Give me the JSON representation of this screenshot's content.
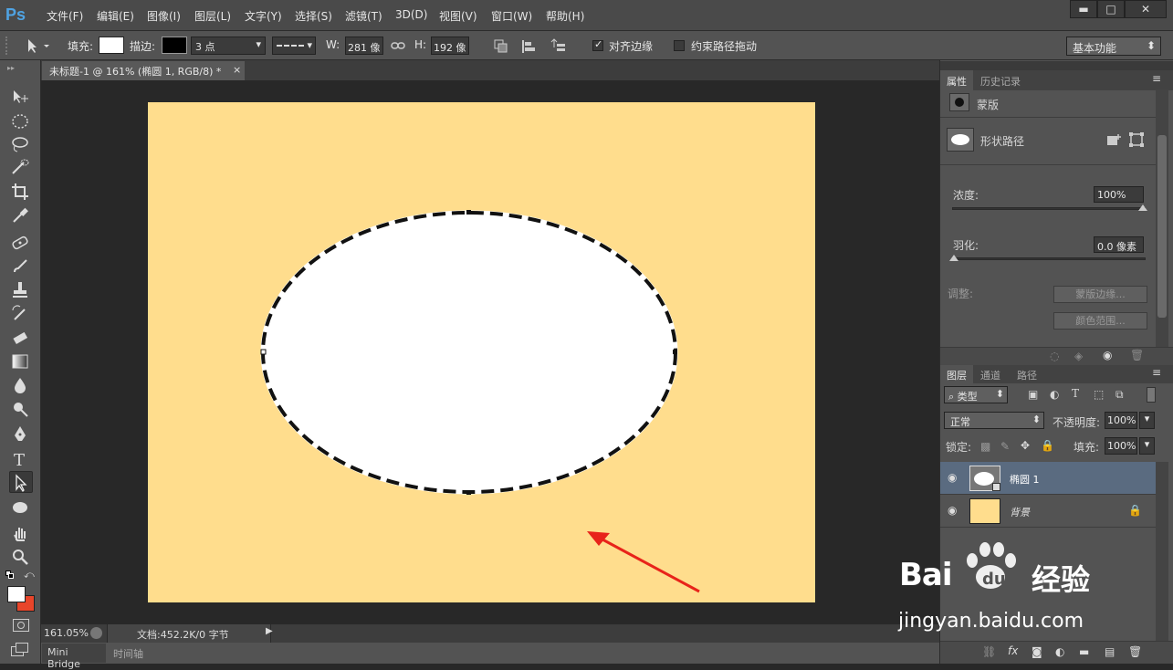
{
  "app": {
    "logo": "Ps"
  },
  "menu": [
    "文件(F)",
    "编辑(E)",
    "图像(I)",
    "图层(L)",
    "文字(Y)",
    "选择(S)",
    "滤镜(T)",
    "3D(D)",
    "视图(V)",
    "窗口(W)",
    "帮助(H)"
  ],
  "window_controls": {
    "minimize": "▬",
    "maximize": "□",
    "close": "✕"
  },
  "options": {
    "fill_label": "填充:",
    "stroke_label": "描边:",
    "stroke_width": "3 点",
    "w_label": "W:",
    "w_value": "281 像",
    "h_label": "H:",
    "h_value": "192 像",
    "align_edges": "对齐边缘",
    "constrain": "约束路径拖动",
    "workspace": "基本功能",
    "align_edges_checked": true,
    "constrain_checked": false
  },
  "document": {
    "tab_title": "未标题-1 @ 161% (椭圆 1, RGB/8) *",
    "tab_close": "×",
    "canvas_color": "#ffdd8d",
    "status_zoom": "161.05%",
    "status_doc": "文档:452.2K/0 字节"
  },
  "bottom_tabs": [
    "Mini Bridge",
    "时间轴"
  ],
  "properties": {
    "tabs": [
      "属性",
      "历史记录"
    ],
    "mask_label": "蒙版",
    "shape_path_label": "形状路径",
    "density_label": "浓度:",
    "density_value": "100%",
    "feather_label": "羽化:",
    "feather_value": "0.0 像素",
    "adjust_label": "调整:",
    "mask_edge_btn": "蒙版边缘...",
    "color_range_btn": "颜色范围..."
  },
  "layers_panel": {
    "tabs": [
      "图层",
      "通道",
      "路径"
    ],
    "filter_kind": "类型",
    "blend_mode": "正常",
    "opacity_label": "不透明度:",
    "opacity_value": "100%",
    "lock_label": "锁定:",
    "fill_label": "填充:",
    "fill_value": "100%",
    "layers": [
      {
        "name": "椭圆 1",
        "selected": true
      },
      {
        "name": "背景",
        "selected": false,
        "locked": true
      }
    ]
  },
  "watermark": {
    "brand": "Bai",
    "brand2": "经验",
    "url": "jingyan.baidu.com"
  },
  "colors": {
    "accent": "#4fa3e3",
    "selected_layer": "#5a6b80",
    "arrow": "#e8231a",
    "background_swatch": "#e8452a"
  }
}
